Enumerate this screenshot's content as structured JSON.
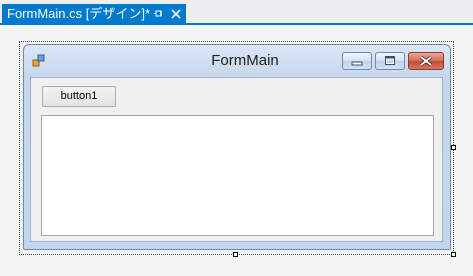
{
  "document_tab": {
    "title": "FormMain.cs [デザイン]*",
    "pin_icon": "pin-icon",
    "close_icon": "close-icon"
  },
  "form": {
    "title": "FormMain",
    "icon": "form-window-icon",
    "caption_buttons": [
      "minimize-icon",
      "maximize-icon",
      "close-icon"
    ]
  },
  "controls": {
    "button1_label": "button1",
    "textbox_value": ""
  },
  "colors": {
    "accent": "#007acc",
    "close_button": "#c44a33",
    "form_frame": "#c3d6ef"
  }
}
